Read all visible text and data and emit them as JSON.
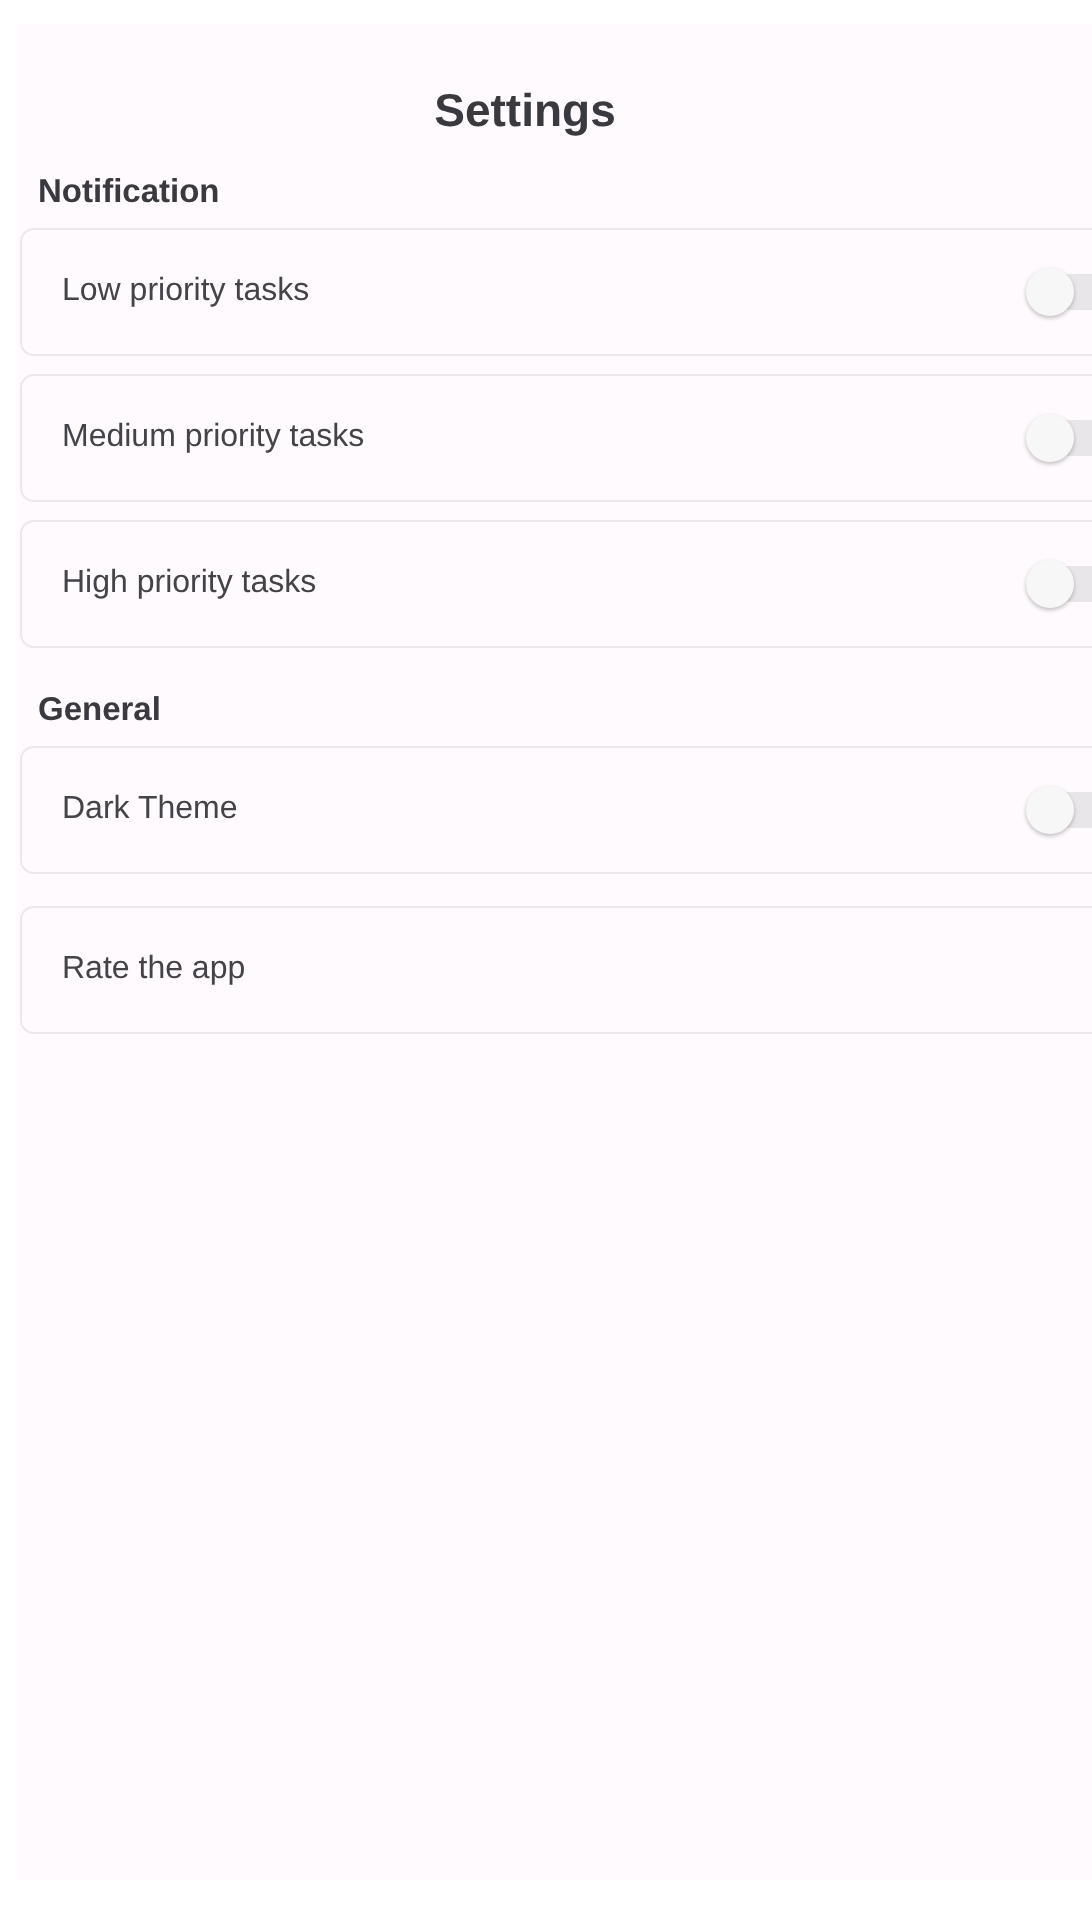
{
  "title": "Settings",
  "sections": [
    {
      "heading": "Notification",
      "items": [
        {
          "kind": "switch",
          "label": "Low priority tasks",
          "on": false
        },
        {
          "kind": "switch",
          "label": "Medium priority tasks",
          "on": false
        },
        {
          "kind": "switch",
          "label": "High priority tasks",
          "on": false
        }
      ]
    },
    {
      "heading": "General",
      "items": [
        {
          "kind": "switch",
          "label": "Dark Theme",
          "on": false
        },
        {
          "kind": "link",
          "label": "Rate the app"
        }
      ]
    }
  ]
}
